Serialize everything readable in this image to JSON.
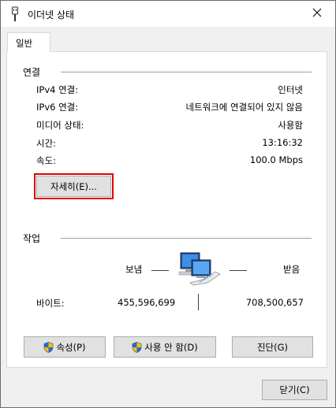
{
  "window": {
    "title": "이더넷 상태",
    "icons": {
      "app": "ethernet-adapter-icon",
      "close": "close-icon"
    }
  },
  "tabs": [
    {
      "label": "일반",
      "selected": true
    }
  ],
  "connection": {
    "section_title": "연결",
    "rows": [
      {
        "label": "IPv4 연결:",
        "value": "인터넷"
      },
      {
        "label": "IPv6 연결:",
        "value": "네트워크에 연결되어 있지 않음"
      },
      {
        "label": "미디어 상태:",
        "value": "사용함"
      },
      {
        "label": "시간:",
        "value": "13:16:32"
      },
      {
        "label": "속도:",
        "value": "100.0 Mbps"
      }
    ],
    "details_button": "자세히(E)..."
  },
  "activity": {
    "section_title": "작업",
    "sent_label": "보냄",
    "received_label": "받음",
    "bytes_label": "바이트:",
    "sent_bytes": "455,596,699",
    "received_bytes": "708,500,657",
    "icon": "network-computers-icon"
  },
  "actions": {
    "properties": "속성(P)",
    "disable": "사용 안 함(D)",
    "diagnose": "진단(G)",
    "shield_icon": "uac-shield-icon"
  },
  "footer": {
    "close_button": "닫기(C)"
  },
  "colors": {
    "highlight": "#e00000",
    "button_bg": "#e1e1e1",
    "window_bg": "#f0f0f0"
  }
}
